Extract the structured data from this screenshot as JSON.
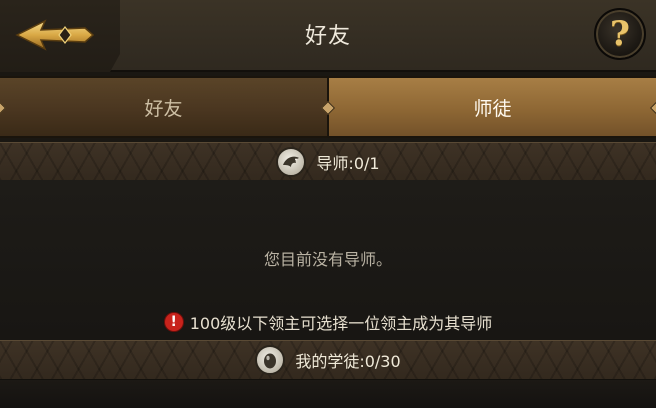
{
  "header": {
    "title": "好友",
    "back_icon": "arrow-left-icon",
    "help_icon": "question-mark-icon",
    "help_glyph": "?"
  },
  "tabs": [
    {
      "label": "好友",
      "selected": false
    },
    {
      "label": "师徒",
      "selected": true
    }
  ],
  "mentor_section": {
    "icon": "eagle-emblem-icon",
    "label": "导师:0/1"
  },
  "content": {
    "empty_message": "您目前没有导师。",
    "hint_icon": "warning-icon",
    "hint_glyph": "!",
    "hint_text": "100级以下领主可选择一位领主成为其导师"
  },
  "apprentice_section": {
    "icon": "egg-emblem-icon",
    "label": "我的学徒:0/30"
  },
  "colors": {
    "accent_gold": "#e9c36a",
    "tab_selected": "#8e6734",
    "warning_red": "#c8231c"
  }
}
